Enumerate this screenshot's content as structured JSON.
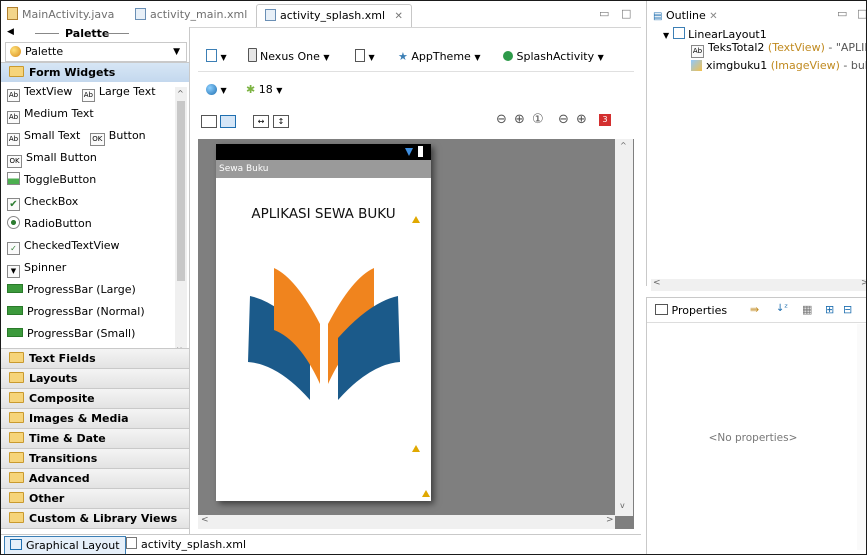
{
  "editor_tabs": [
    {
      "label": "MainActivity.java"
    },
    {
      "label": "activity_main.xml"
    },
    {
      "label": "activity_splash.xml",
      "close": "✕"
    }
  ],
  "palette": {
    "title": "Palette",
    "selector": "Palette",
    "form_widgets_label": "Form Widgets",
    "items": [
      {
        "label": "TextView",
        "icon_text": "Ab"
      },
      {
        "label": "Large Text",
        "icon_text": "Ab"
      },
      {
        "label": "Medium Text",
        "icon_text": "Ab"
      },
      {
        "label": "Small Text",
        "icon_text": "Ab"
      },
      {
        "label": "Button",
        "icon_text": "OK"
      },
      {
        "label": "Small Button",
        "icon_text": "OK"
      },
      {
        "label": "ToggleButton"
      },
      {
        "label": "CheckBox"
      },
      {
        "label": "RadioButton"
      },
      {
        "label": "CheckedTextView"
      },
      {
        "label": "Spinner"
      },
      {
        "label": "ProgressBar (Large)"
      },
      {
        "label": "ProgressBar (Normal)"
      },
      {
        "label": "ProgressBar (Small)"
      }
    ],
    "groups": [
      "Text Fields",
      "Layouts",
      "Composite",
      "Images & Media",
      "Time & Date",
      "Transitions",
      "Advanced",
      "Other",
      "Custom & Library Views"
    ]
  },
  "toolbar": {
    "device": "Nexus One",
    "theme": "AppTheme",
    "activity": "SplashActivity",
    "api_level": "18",
    "error_count": "3"
  },
  "device_preview": {
    "app_title": "Sewa Buku",
    "heading": "APLIKASI SEWA BUKU",
    "book_colors": {
      "blue": "#1b5a8a",
      "orange": "#f0841e"
    }
  },
  "bottom_tabs": [
    "Graphical Layout",
    "activity_splash.xml"
  ],
  "outline": {
    "title": "Outline",
    "root": "LinearLayout1",
    "children": [
      {
        "name": "TeksTotal2",
        "type": "(TextView)",
        "suffix": " - \"APLIKASI"
      },
      {
        "name": "ximgbuku1",
        "type": "(ImageView)",
        "suffix": " - buku"
      }
    ]
  },
  "properties": {
    "title": "Properties",
    "empty": "<No properties>"
  }
}
